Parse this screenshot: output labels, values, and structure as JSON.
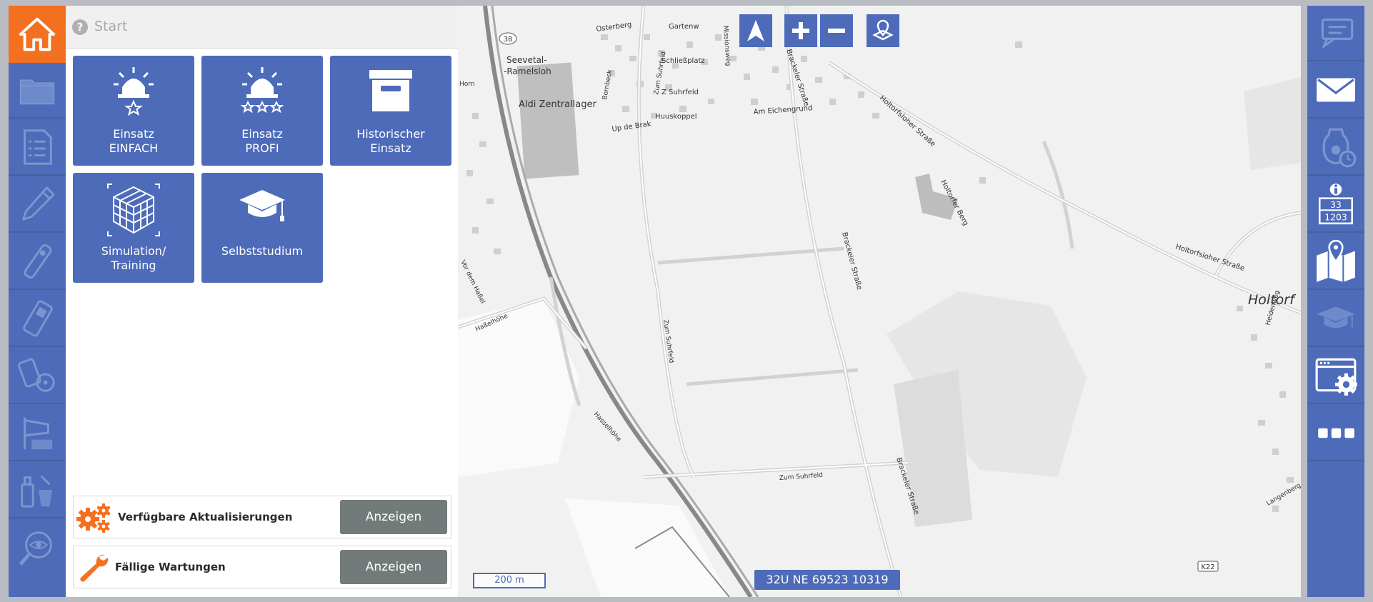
{
  "header": {
    "title": "Start"
  },
  "tiles": [
    {
      "id": "einsatz-einfach",
      "label": "Einsatz\nEINFACH"
    },
    {
      "id": "einsatz-profi",
      "label": "Einsatz\nPROFI"
    },
    {
      "id": "historischer-einsatz",
      "label": "Historischer\nEinsatz"
    },
    {
      "id": "simulation-training",
      "label": "Simulation/\nTraining"
    },
    {
      "id": "selbststudium",
      "label": "Selbststudium"
    }
  ],
  "status_rows": [
    {
      "label": "Verfügbare Aktualisierungen",
      "button": "Anzeigen"
    },
    {
      "label": "Fällige Wartungen",
      "button": "Anzeigen"
    }
  ],
  "left_rail": {
    "items": [
      "home-icon",
      "folder-icon",
      "checklist-icon",
      "pen-icon",
      "gas-detector-icon",
      "handheld-device-icon",
      "radiation-meter-icon",
      "windsock-icon",
      "chemical-bottles-icon",
      "search-eye-icon"
    ]
  },
  "right_rail": {
    "items": [
      "chat-icon",
      "mail-icon",
      "breathing-timer-icon",
      "hazard-info-icon",
      "map-pin-icon",
      "education-icon",
      "settings-window-icon",
      "more-icon"
    ],
    "hazard_panel": {
      "top": "33",
      "bottom": "1203"
    }
  },
  "map": {
    "labels": {
      "seevetal": "Seevetal-",
      "ramelsloh": "-Ramelsloh",
      "aldi": "Aldi Zentrallager",
      "osterberg": "Osterberg",
      "gartenw": "Gartenw",
      "schliessplatz": "Schließplatz",
      "zum_suhrfeld_top": "Zum Suhrfeld",
      "z_suhrfeld": "Z Suhrfeld",
      "huuskoppel": "Huuskoppel",
      "am_eichengrund": "Am Eichengrund",
      "up_de_brak": "Up de Brak",
      "brakeler_strasse_top": "Brackeler Straße",
      "holtorfsloher_strasse": "Holtorfsloher Straße",
      "holtorfer_berg": "Holtorfer Berg",
      "holtorfsloher_strasse_2": "Holtorfsloher Straße",
      "holtorf": "Holtorf",
      "brakeler_strasse_mid": "Brackeler Straße",
      "zum_suhrfeld_mid": "Zum Suhrfeld",
      "zum_suhrfeld_bottom": "Zum Suhrfeld",
      "brakeler_strasse_bottom": "Brackeler Straße",
      "hasselhohe": "Haßelhöhe",
      "hasselhohe_2": "Hasselhöhe",
      "vor_dem_hassel": "Vor dem Haßel",
      "horn": "Horn",
      "k22": "K22",
      "route_38": "38",
      "bornbeck": "Bornbeck",
      "missionsweg": "Missionsweg",
      "heidenweg": "Heidenweg",
      "langenberg": "Langenberg"
    },
    "scale": "200 m",
    "coordinates": "32U NE 69523 10319",
    "controls": [
      "north-arrow-icon",
      "zoom-in-icon",
      "zoom-out-icon",
      "locate-icon"
    ]
  },
  "colors": {
    "accent": "#f37021",
    "brand": "#4d6bb9",
    "button_gray": "#727b79"
  }
}
